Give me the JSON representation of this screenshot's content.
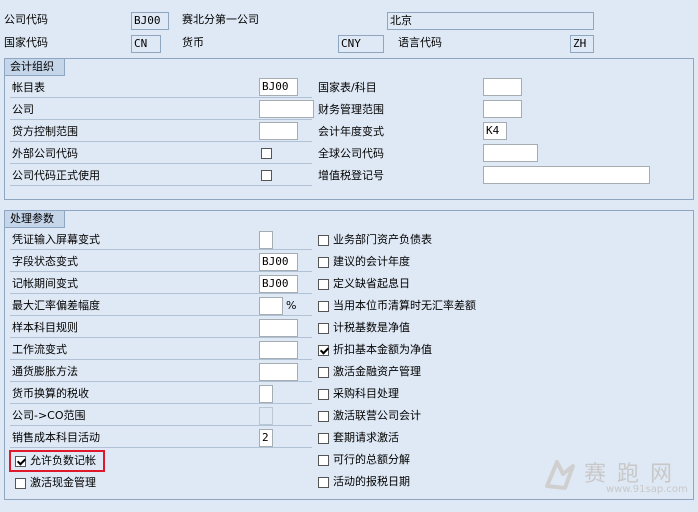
{
  "header": {
    "company_code_label": "公司代码",
    "company_code": "BJ00",
    "company_name": "赛北分第一公司",
    "city": "北京",
    "country_label": "国家代码",
    "country": "CN",
    "currency_label": "货币",
    "currency": "CNY",
    "language_label": "语言代码",
    "language": "ZH"
  },
  "accounting": {
    "title": "会计组织",
    "chart_label": "帐目表",
    "chart_value": "BJ00",
    "company_label": "公司",
    "company_value": "",
    "credit_label": "贷方控制范围",
    "credit_value": "",
    "ext_label": "外部公司代码",
    "prod_label": "公司代码正式使用",
    "country_chart_label": "国家表/科目",
    "country_chart_value": "",
    "fm_label": "财务管理范围",
    "fm_value": "",
    "fy_label": "会计年度变式",
    "fy_value": "K4",
    "global_label": "全球公司代码",
    "global_value": "",
    "vat_label": "增值税登记号",
    "vat_value": ""
  },
  "processing": {
    "title": "处理参数",
    "left": [
      {
        "label": "凭证输入屏幕变式",
        "value": ""
      },
      {
        "label": "字段状态变式",
        "value": "BJ00"
      },
      {
        "label": "记帐期间变式",
        "value": "BJ00"
      },
      {
        "label": "最大汇率偏差幅度",
        "value": "",
        "unit": "%"
      },
      {
        "label": "样本科目规则",
        "value": ""
      },
      {
        "label": "工作流变式",
        "value": ""
      },
      {
        "label": "通货膨胀方法",
        "value": ""
      },
      {
        "label": "货币换算的税收",
        "value": ""
      },
      {
        "label": "公司->CO范围",
        "value": ""
      },
      {
        "label": "销售成本科目活动",
        "value": "2"
      }
    ],
    "neg_posting_label": "允许负数记帐",
    "neg_posting_checked": true,
    "cash_mgmt_label": "激活现金管理",
    "cash_mgmt_checked": false,
    "right": [
      {
        "label": "业务部门资产负债表",
        "checked": false
      },
      {
        "label": "建议的会计年度",
        "checked": false
      },
      {
        "label": "定义缺省起息日",
        "checked": false
      },
      {
        "label": "当用本位币清算时无汇率差额",
        "checked": false
      },
      {
        "label": "计税基数是净值",
        "checked": false
      },
      {
        "label": "折扣基本金额为净值",
        "checked": true
      },
      {
        "label": "激活金融资产管理",
        "checked": false
      },
      {
        "label": "采购科目处理",
        "checked": false
      },
      {
        "label": "激活联营公司会计",
        "checked": false
      },
      {
        "label": "套期请求激活",
        "checked": false
      },
      {
        "label": "可行的总额分解",
        "checked": false
      },
      {
        "label": "活动的报税日期",
        "checked": false
      }
    ]
  },
  "watermark": {
    "cn": "赛 跑 网",
    "url": "www.91sap.com"
  },
  "colors": {
    "background": "#dfe9f5",
    "group_title": "#c5d6ea",
    "highlight": "#e0182c"
  }
}
